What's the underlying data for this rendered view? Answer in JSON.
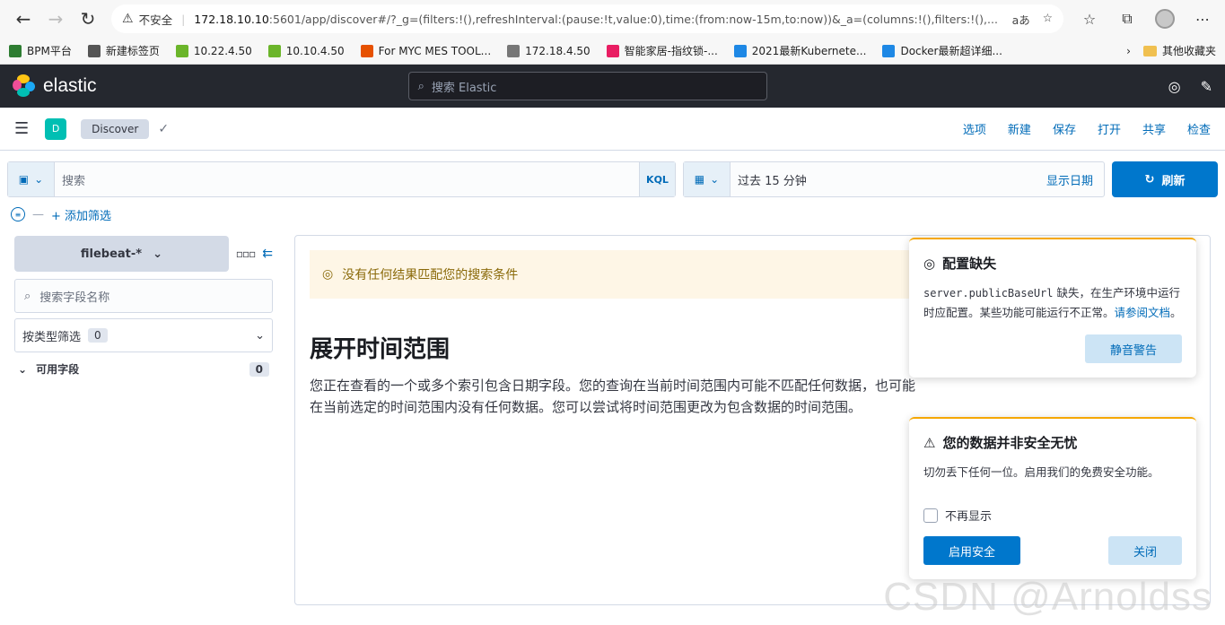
{
  "browser": {
    "insecure_label": "不安全",
    "url_host": "172.18.10.10",
    "url_path": ":5601/app/discover#/?_g=(filters:!(),refreshInterval:(pause:!t,value:0),time:(from:now-15m,to:now))&_a=(columns:!(),filters:!(),...",
    "bookmarks": [
      {
        "label": "BPM平台",
        "color": "#2e7d32"
      },
      {
        "label": "新建标签页",
        "color": "#555555"
      },
      {
        "label": "10.22.4.50",
        "color": "#6bb52a"
      },
      {
        "label": "10.10.4.50",
        "color": "#6bb52a"
      },
      {
        "label": "For MYC MES TOOL...",
        "color": "#e65100"
      },
      {
        "label": "172.18.4.50",
        "color": "#777777"
      },
      {
        "label": "智能家居-指纹锁-...",
        "color": "#e91e63"
      },
      {
        "label": "2021最新Kubernete...",
        "color": "#1e88e5"
      },
      {
        "label": "Docker最新超详细...",
        "color": "#1e88e5"
      }
    ],
    "other_bookmarks": "其他收藏夹"
  },
  "header": {
    "brand": "elastic",
    "search_placeholder": "搜索 Elastic"
  },
  "nav": {
    "space_initial": "D",
    "breadcrumb": "Discover",
    "links": [
      "选项",
      "新建",
      "保存",
      "打开",
      "共享",
      "检查"
    ]
  },
  "query": {
    "placeholder": "搜索",
    "language": "KQL",
    "time_range": "过去 15 分钟",
    "show_dates": "显示日期",
    "refresh": "刷新",
    "add_filter": "+ 添加筛选"
  },
  "sidebar": {
    "index_pattern": "filebeat-*",
    "field_search_placeholder": "搜索字段名称",
    "filter_by_type": "按类型筛选",
    "filter_count": "0",
    "available_fields": "可用字段",
    "available_count": "0"
  },
  "main": {
    "callout": "没有任何结果匹配您的搜索条件",
    "heading": "展开时间范围",
    "body": "您正在查看的一个或多个索引包含日期字段。您的查询在当前时间范围内可能不匹配任何数据，也可能在当前选定的时间范围内没有任何数据。您可以尝试将时间范围更改为包含数据的时间范围。"
  },
  "toast_config": {
    "title": "配置缺失",
    "code": "server.publicBaseUrl",
    "body": " 缺失，在生产环境中运行时应配置。某些功能可能运行不正常。",
    "link": "请参阅文档",
    "link_end": "。",
    "button": "静音警告"
  },
  "toast_security": {
    "title": "您的数据并非安全无忧",
    "body": "切勿丢下任何一位。启用我们的免费安全功能。",
    "checkbox": "不再显示",
    "primary": "启用安全",
    "secondary": "关闭"
  },
  "watermark": "CSDN @Arnoldss"
}
